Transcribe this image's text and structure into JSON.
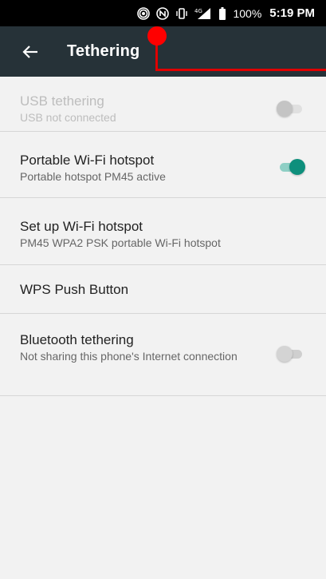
{
  "status_bar": {
    "battery": "100%",
    "time": "5:19 PM",
    "network": "4G"
  },
  "toolbar": {
    "title": "Tethering"
  },
  "items": [
    {
      "title": "USB tethering",
      "subtitle": "USB not connected",
      "toggle": "off",
      "enabled": false
    },
    {
      "title": "Portable Wi-Fi hotspot",
      "subtitle": "Portable hotspot PM45 active",
      "toggle": "on",
      "enabled": true
    },
    {
      "title": "Set up Wi-Fi hotspot",
      "subtitle": "PM45 WPA2 PSK portable Wi-Fi hotspot",
      "enabled": true
    },
    {
      "title": "WPS Push Button",
      "enabled": true
    },
    {
      "title": "Bluetooth tethering",
      "subtitle": "Not sharing this phone's Internet connection",
      "toggle": "off",
      "enabled": true
    }
  ],
  "colors": {
    "toolbar": "#263238",
    "status_bar": "#000000",
    "accent": "#0e8f7c",
    "annotation": "#ff0000"
  }
}
